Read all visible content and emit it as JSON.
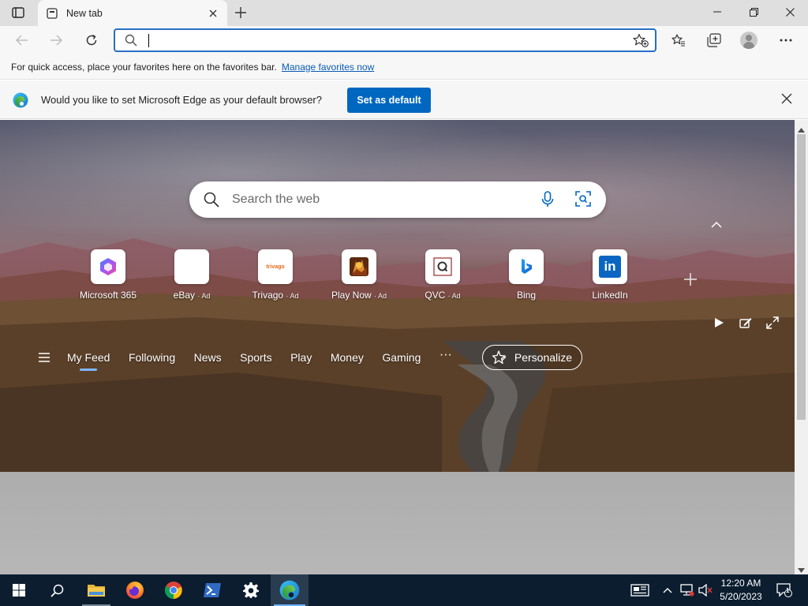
{
  "browser": {
    "tab": {
      "title": "New tab"
    },
    "address": {
      "value": "",
      "placeholder": ""
    }
  },
  "favorites_bar": {
    "message": "For quick access, place your favorites here on the favorites bar.",
    "link": "Manage favorites now"
  },
  "banner": {
    "message": "Would you like to set Microsoft Edge as your default browser?",
    "button": "Set as default"
  },
  "newtab": {
    "search_placeholder": "Search the web",
    "quick_links": [
      {
        "label": "Microsoft 365",
        "ad": "",
        "icon": "microsoft-365-icon"
      },
      {
        "label": "eBay",
        "ad": "· Ad",
        "icon": "ebay-icon"
      },
      {
        "label": "Trivago",
        "ad": "· Ad",
        "icon": "trivago-icon",
        "icon_text": "trivago"
      },
      {
        "label": "Play Now",
        "ad": "· Ad",
        "icon": "play-now-icon"
      },
      {
        "label": "QVC",
        "ad": "· Ad",
        "icon": "qvc-icon"
      },
      {
        "label": "Bing",
        "ad": "",
        "icon": "bing-icon"
      },
      {
        "label": "LinkedIn",
        "ad": "",
        "icon": "linkedin-icon",
        "icon_text": "in"
      }
    ],
    "feed_nav": [
      "My Feed",
      "Following",
      "News",
      "Sports",
      "Play",
      "Money",
      "Gaming"
    ],
    "more": "···",
    "personalize": "Personalize"
  },
  "taskbar": {
    "time": "12:20 AM",
    "date": "5/20/2023",
    "notifications_count": "1"
  },
  "colors": {
    "accent": "#0067c0",
    "link": "#0a5bb5",
    "taskbar": "#0b1d2f"
  }
}
